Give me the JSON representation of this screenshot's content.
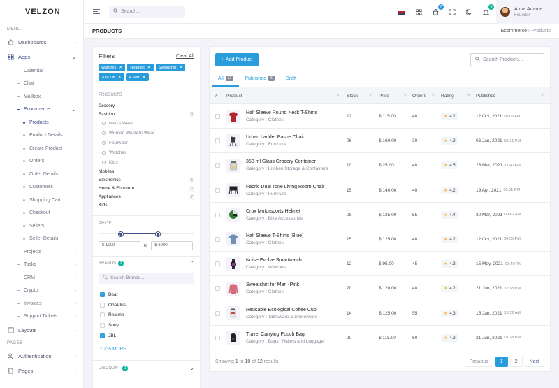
{
  "brand": {
    "logo": "VELZON"
  },
  "sidebar": {
    "menu_title": "MENU",
    "pages_title": "PAGES",
    "items": [
      {
        "label": "Dashboards"
      },
      {
        "label": "Apps"
      },
      {
        "label": "Layouts"
      },
      {
        "label": "Authentication"
      },
      {
        "label": "Pages"
      }
    ],
    "apps_sub": [
      {
        "label": "Calendar"
      },
      {
        "label": "Chat"
      },
      {
        "label": "Mailbox"
      },
      {
        "label": "Ecommerce"
      },
      {
        "label": "Projects"
      },
      {
        "label": "Tasks"
      },
      {
        "label": "CRM"
      },
      {
        "label": "Crypto"
      },
      {
        "label": "Invoices"
      },
      {
        "label": "Support Tickets"
      }
    ],
    "ecommerce_sub": [
      {
        "label": "Products"
      },
      {
        "label": "Product Details"
      },
      {
        "label": "Create Product"
      },
      {
        "label": "Orders"
      },
      {
        "label": "Order Details"
      },
      {
        "label": "Customers"
      },
      {
        "label": "Shopping Cart"
      },
      {
        "label": "Checkout"
      },
      {
        "label": "Sellers"
      },
      {
        "label": "Seller Details"
      }
    ]
  },
  "topbar": {
    "search_placeholder": "Search...",
    "cart_badge": "7",
    "notif_badge": "3",
    "user_name": "Anna Adame",
    "user_role": "Founder"
  },
  "page": {
    "title": "PRODUCTS",
    "crumb_1": "Ecommerce",
    "crumb_2": "Products"
  },
  "filters": {
    "title": "Filters",
    "clear_all": "Clear All",
    "chips": [
      "Watches",
      "Headset",
      "Sweatshirt",
      "20% Off",
      "4 Star"
    ],
    "products_label": "PRODUCTS",
    "categories": [
      {
        "name": "Grocery",
        "count": ""
      },
      {
        "name": "Fashion",
        "count": "5"
      },
      {
        "name": "Mobiles",
        "count": ""
      },
      {
        "name": "Electronics",
        "count": "5"
      },
      {
        "name": "Home & Furniture",
        "count": "6"
      },
      {
        "name": "Appliances",
        "count": "7"
      },
      {
        "name": "Kids",
        "count": ""
      }
    ],
    "fashion_sub": [
      "Men's Wear",
      "Women Western Wear",
      "Footwear",
      "Watches",
      "Kids"
    ],
    "price_label": "PRICE",
    "price_min": "$ 1000",
    "price_to": "to",
    "price_max": "$ 3000",
    "price_range": [
      0.23,
      0.62
    ],
    "brands_label": "BRANDS",
    "brands_badge": "2",
    "brand_search_placeholder": "Search Brands...",
    "brands": [
      {
        "name": "Boat",
        "checked": true
      },
      {
        "name": "OnePlus",
        "checked": false
      },
      {
        "name": "Realme",
        "checked": false
      },
      {
        "name": "Sony",
        "checked": false
      },
      {
        "name": "JBL",
        "checked": true
      }
    ],
    "more": "1,235 MORE",
    "discount_label": "DISCOUNT",
    "discount_badge": "1"
  },
  "products": {
    "add_button": "Add Product",
    "search_placeholder": "Search Products...",
    "tabs": [
      {
        "label": "All",
        "count": "12"
      },
      {
        "label": "Published",
        "count": "5"
      },
      {
        "label": "Draft",
        "count": ""
      }
    ],
    "columns": [
      "#",
      "Product",
      "Stock",
      "Price",
      "Orders",
      "Rating",
      "Published"
    ],
    "rows": [
      {
        "name": "Half Sleeve Round Neck T-Shirts",
        "category": "Category : Clothes",
        "stock": "12",
        "price": "$ 115.00",
        "orders": "48",
        "rating": "4.2",
        "date": "12 Oct, 2021",
        "time": "10:05 AM",
        "icon": "tshirt-red"
      },
      {
        "name": "Urban Ladder Pashe Chair",
        "category": "Category : Furniture",
        "stock": "06",
        "price": "$ 160.00",
        "orders": "30",
        "rating": "4.3",
        "date": "06 Jan, 2021",
        "time": "01:31 PM",
        "icon": "chair"
      },
      {
        "name": "350 ml Glass Grocery Container",
        "category": "Category : Kitchen Storage & Containers",
        "stock": "10",
        "price": "$ 25.00",
        "orders": "48",
        "rating": "4.5",
        "date": "26 Mar, 2021",
        "time": "11:40 AM",
        "icon": "jar"
      },
      {
        "name": "Fabric Dual Tone Living Room Chair",
        "category": "Category : Furniture",
        "stock": "15",
        "price": "$ 140.00",
        "orders": "40",
        "rating": "4.2",
        "date": "19 Apr, 2021",
        "time": "02:51 PM",
        "icon": "chair-dark"
      },
      {
        "name": "Crux Motorsports Helmet",
        "category": "Category : Bike Accessories",
        "stock": "08",
        "price": "$ 135.00",
        "orders": "55",
        "rating": "4.4",
        "date": "30 Mar, 2021",
        "time": "09:42 AM",
        "icon": "helmet"
      },
      {
        "name": "Half Sleeve T-Shirts (Blue)",
        "category": "Category : Clothes",
        "stock": "15",
        "price": "$ 125.00",
        "orders": "48",
        "rating": "4.2",
        "date": "12 Oct, 2021",
        "time": "04:55 PM",
        "icon": "tshirt-blue"
      },
      {
        "name": "Noise Evolve Smartwatch",
        "category": "Category : Watches",
        "stock": "12",
        "price": "$ 95.00",
        "orders": "45",
        "rating": "4.3",
        "date": "15 May, 2021",
        "time": "03:40 PM",
        "icon": "watch"
      },
      {
        "name": "Sweatshirt for Men (Pink)",
        "category": "Category : Clothes",
        "stock": "20",
        "price": "$ 120.00",
        "orders": "48",
        "rating": "4.2",
        "date": "21 Jun, 2021",
        "time": "12:18 PM",
        "icon": "sweatshirt"
      },
      {
        "name": "Reusable Ecological Coffee Cup",
        "category": "Category : Tableware & Dinnerware",
        "stock": "14",
        "price": "$ 125.00",
        "orders": "55",
        "rating": "4.3",
        "date": "15 Jan, 2021",
        "time": "10:52 AM",
        "icon": "cup"
      },
      {
        "name": "Travel Carrying Pouch Bag",
        "category": "Category : Bags, Wallets and Luggage",
        "stock": "20",
        "price": "$ 115.00",
        "orders": "60",
        "rating": "4.3",
        "date": "21 Jun, 2021",
        "time": "01:28 PM",
        "icon": "bag"
      }
    ],
    "showing_prefix": "Showing",
    "showing_from": "1",
    "showing_to_word": "to",
    "showing_to": "10",
    "showing_of": "of",
    "showing_total": "12",
    "showing_suffix": "results",
    "pager": {
      "prev": "Previous",
      "p1": "1",
      "p2": "2",
      "next": "Next"
    }
  }
}
